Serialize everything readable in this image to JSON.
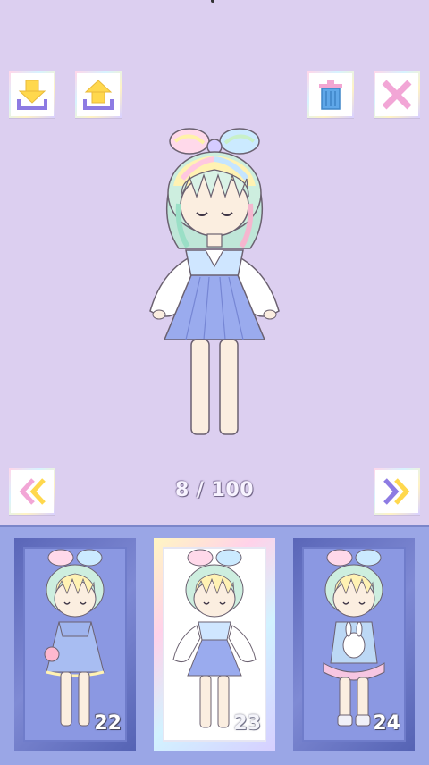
{
  "page": {
    "current": "8",
    "total": "100",
    "label": "8 / 100"
  },
  "toolbar": {
    "download_icon": "download-icon",
    "upload_icon": "upload-icon",
    "delete_icon": "trash-icon",
    "close_icon": "close-icon"
  },
  "navigation": {
    "prev_icon": "double-chevron-left-icon",
    "next_icon": "double-chevron-right-icon"
  },
  "slots": [
    {
      "number": "22",
      "selected": false
    },
    {
      "number": "23",
      "selected": true
    },
    {
      "number": "24",
      "selected": false
    }
  ],
  "colors": {
    "background": "#dccff0",
    "tray": "#9aa6e6",
    "close_pink": "#f2a6d6",
    "trash_blue": "#5fa7e8",
    "arrow_yellow": "#ffd84d",
    "arrow_purple": "#8d7be3"
  }
}
